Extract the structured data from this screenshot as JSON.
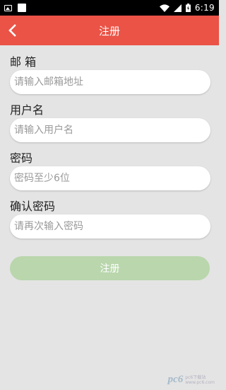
{
  "status_bar": {
    "time": "6:19",
    "icons": [
      "image-icon",
      "square-icon",
      "wifi-icon",
      "signal-icon",
      "battery-icon"
    ]
  },
  "app_bar": {
    "title": "注册",
    "back_icon": "chevron-left-icon",
    "background_color": "#ea5346"
  },
  "form": {
    "email": {
      "label": "邮 箱",
      "placeholder": "请输入邮箱地址",
      "value": ""
    },
    "username": {
      "label": "用户名",
      "placeholder": "请输入用户名",
      "value": ""
    },
    "password": {
      "label": "密码",
      "placeholder": "密码至少6位",
      "value": ""
    },
    "confirm_password": {
      "label": "确认密码",
      "placeholder": "请再次输入密码",
      "value": ""
    },
    "submit_label": "注册",
    "submit_color": "#b9d6ac"
  },
  "watermark": {
    "logo": "pc6",
    "line1": "pc6下载站",
    "line2": "www.pc6.com"
  }
}
